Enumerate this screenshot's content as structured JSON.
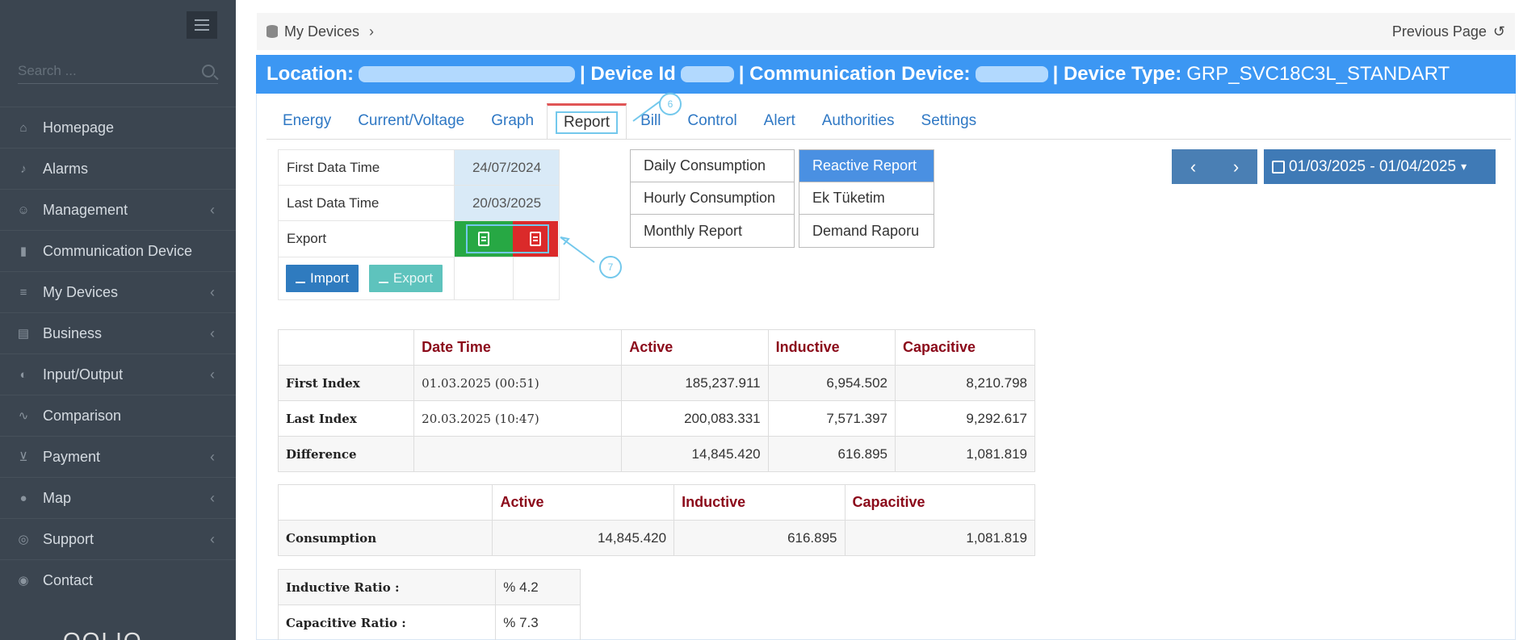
{
  "sidebar": {
    "search_placeholder": "Search ...",
    "items": [
      {
        "label": "Homepage",
        "icon": "home-icon",
        "chevron": ""
      },
      {
        "label": "Alarms",
        "icon": "bell-icon",
        "chevron": ""
      },
      {
        "label": "Management",
        "icon": "users-icon",
        "chevron": "‹"
      },
      {
        "label": "Communication Device",
        "icon": "signal-icon",
        "chevron": ""
      },
      {
        "label": "My Devices",
        "icon": "database-icon",
        "chevron": "‹"
      },
      {
        "label": "Business",
        "icon": "building-icon",
        "chevron": "‹"
      },
      {
        "label": "Input/Output",
        "icon": "toggle-icon",
        "chevron": "‹"
      },
      {
        "label": "Comparison",
        "icon": "line-chart-icon",
        "chevron": ""
      },
      {
        "label": "Payment",
        "icon": "cart-icon",
        "chevron": "‹"
      },
      {
        "label": "Map",
        "icon": "map-pin-icon",
        "chevron": "‹"
      },
      {
        "label": "Support",
        "icon": "support-icon",
        "chevron": "‹"
      },
      {
        "label": "Contact",
        "icon": "globe-icon",
        "chevron": ""
      }
    ],
    "logo_text": "OOLIO"
  },
  "breadcrumb": {
    "label": "My Devices",
    "arrow": "›",
    "prev_page": "Previous Page",
    "refresh": "↺"
  },
  "titlebar": {
    "location_label": "Location:",
    "device_id_label": "| Device Id",
    "comm_label": "| Communication Device:",
    "type_label": "| Device Type:",
    "type_value": "GRP_SVC18C3L_STANDART"
  },
  "tabs": [
    "Energy",
    "Current/Voltage",
    "Graph",
    "Report",
    "Bill",
    "Control",
    "Alert",
    "Authorities",
    "Settings"
  ],
  "callouts": {
    "c6": "6",
    "c7": "7"
  },
  "info": {
    "first_label": "First Data Time",
    "first_value": "24/07/2024",
    "last_label": "Last Data Time",
    "last_value": "20/03/2025",
    "export_label": "Export",
    "import_btn": "Import",
    "export_btn": "Export"
  },
  "reports_left": [
    "Daily Consumption",
    "Hourly Consumption",
    "Monthly Report"
  ],
  "reports_right": [
    "Reactive Report",
    "Ek Tüketim",
    "Demand Raporu"
  ],
  "date_range": "01/03/2025 - 01/04/2025",
  "index_table": {
    "headers": [
      "",
      "Date Time",
      "Active",
      "Inductive",
      "Capacitive"
    ],
    "rows": [
      [
        "First Index",
        "01.03.2025 (00:51)",
        "185,237.911",
        "6,954.502",
        "8,210.798"
      ],
      [
        "Last Index",
        "20.03.2025 (10:47)",
        "200,083.331",
        "7,571.397",
        "9,292.617"
      ],
      [
        "Difference",
        "",
        "14,845.420",
        "616.895",
        "1,081.819"
      ]
    ]
  },
  "consumption_table": {
    "headers": [
      "",
      "Active",
      "Inductive",
      "Capacitive"
    ],
    "row": [
      "Consumption",
      "14,845.420",
      "616.895",
      "1,081.819"
    ]
  },
  "ratio_table": {
    "rows": [
      [
        "Inductive Ratio :",
        "% 4.2"
      ],
      [
        "Capacitive Ratio :",
        "% 7.3"
      ]
    ]
  },
  "colors": {
    "accent": "#3c97f3",
    "sidebar": "#3b4550",
    "header_text": "#8b0a1a",
    "excel": "#27a844",
    "pdf": "#db2a2a"
  }
}
